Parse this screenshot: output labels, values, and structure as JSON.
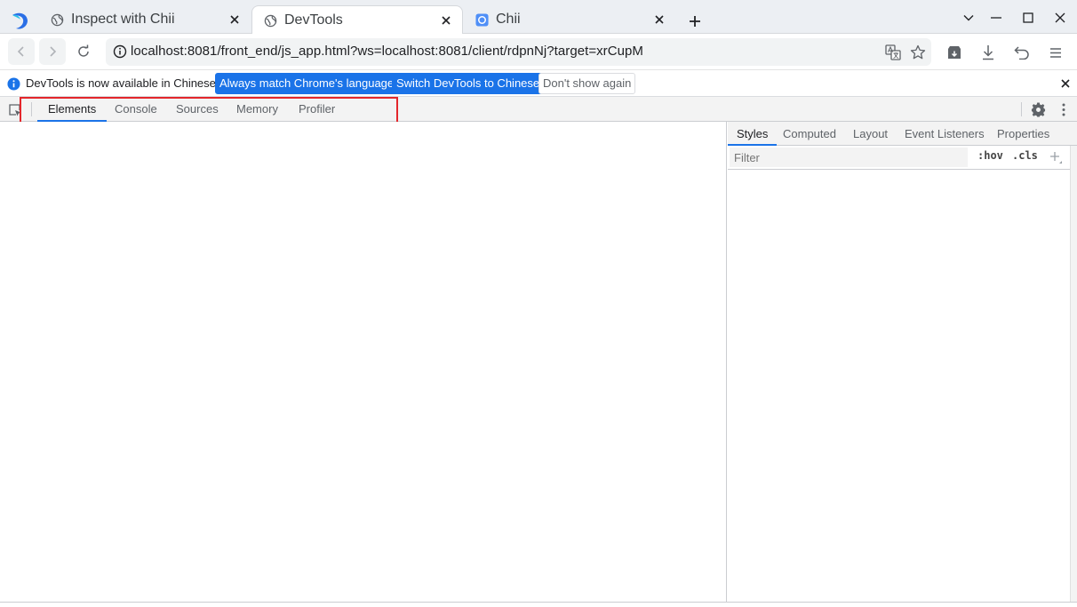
{
  "browser": {
    "tabs": [
      {
        "title": "Inspect with Chii",
        "icon": "globe-icon"
      },
      {
        "title": "DevTools",
        "icon": "globe-icon",
        "active": true
      },
      {
        "title": "Chii",
        "icon": "chii-favicon-icon"
      }
    ],
    "url": "localhost:8081/front_end/js_app.html?ws=localhost:8081/client/rdpnNj?target=xrCupM"
  },
  "infobar": {
    "message": "DevTools is now available in Chinese!",
    "btn_match": "Always match Chrome's language",
    "btn_switch": "Switch DevTools to Chinese",
    "btn_dismiss": "Don't show again"
  },
  "devtools": {
    "tabs": [
      "Elements",
      "Console",
      "Sources",
      "Memory",
      "Profiler"
    ],
    "active_tab": "Elements",
    "side_tabs": [
      "Styles",
      "Computed",
      "Layout",
      "Event Listeners",
      "Properties"
    ],
    "active_side_tab": "Styles",
    "filter_placeholder": "Filter",
    "hov_label": ":hov",
    "cls_label": ".cls"
  },
  "colors": {
    "accent": "#1a73e8",
    "highlight": "#e3262b"
  }
}
